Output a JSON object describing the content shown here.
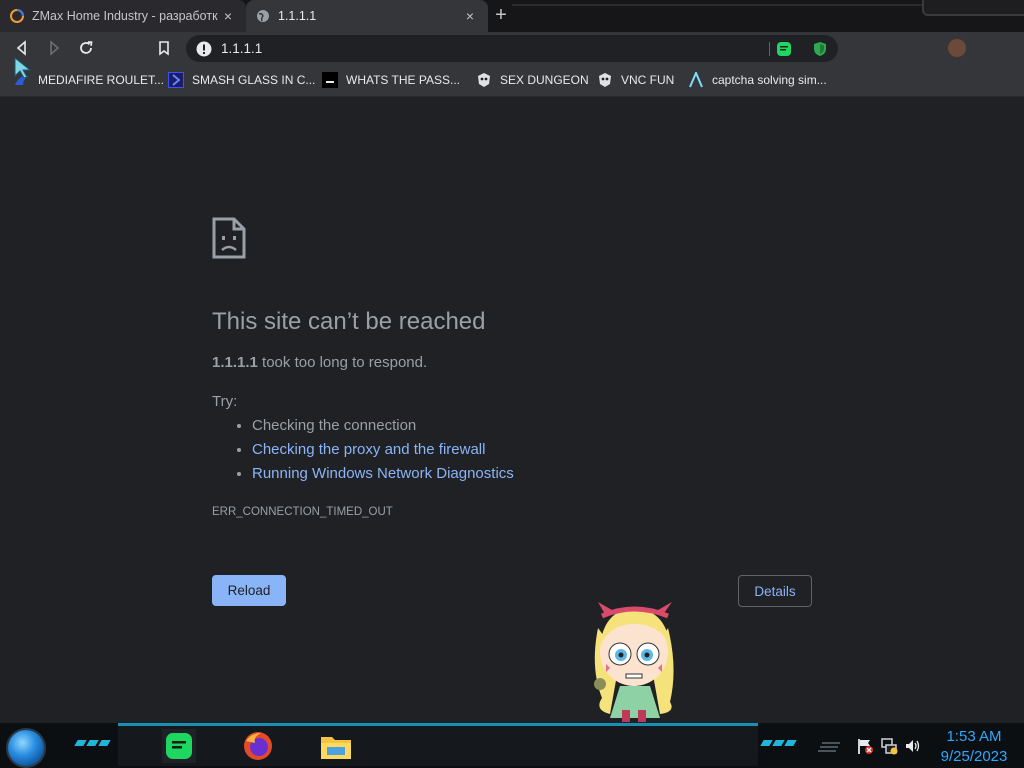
{
  "browser": {
    "tabs": [
      {
        "title": "ZMax Home Industry - разработк",
        "close": "×"
      },
      {
        "title": "1.1.1.1",
        "close": "×"
      }
    ],
    "new_tab": "+",
    "address": "1.1.1.1",
    "bookmarks": [
      {
        "label": "MEDIAFIRE ROULET...",
        "icon": "mediafire-icon",
        "color": "#2b5bd7"
      },
      {
        "label": "SMASH GLASS IN C...",
        "icon": "chevron-icon",
        "color": "#3b55e6"
      },
      {
        "label": "WHATS THE PASS...",
        "icon": "terminal-icon",
        "color": "#000000"
      },
      {
        "label": "SEX DUNGEON",
        "icon": "mask-icon",
        "color": "#e8eaed"
      },
      {
        "label": "VNC FUN",
        "icon": "mask-icon",
        "color": "#e8eaed"
      },
      {
        "label": "captcha solving sim...",
        "icon": "caret-icon",
        "color": "#7fdcff"
      }
    ]
  },
  "error_page": {
    "headline": "This site can’t be reached",
    "host": "1.1.1.1",
    "message": "took too long to respond.",
    "try_label": "Try:",
    "suggestions": [
      {
        "text": "Checking the connection",
        "link": false
      },
      {
        "text": "Checking the proxy and the firewall",
        "link": true
      },
      {
        "text": "Running Windows Network Diagnostics",
        "link": true
      }
    ],
    "error_code": "ERR_CONNECTION_TIMED_OUT",
    "reload_label": "Reload",
    "details_label": "Details"
  },
  "taskbar": {
    "time": "1:53 AM",
    "date": "9/25/2023"
  },
  "colors": {
    "page_bg": "#202124",
    "link": "#8ab4f8",
    "text_muted": "#9aa0a6",
    "clock": "#2ea7ff",
    "taskbar_accent": "#1fb6d9"
  }
}
